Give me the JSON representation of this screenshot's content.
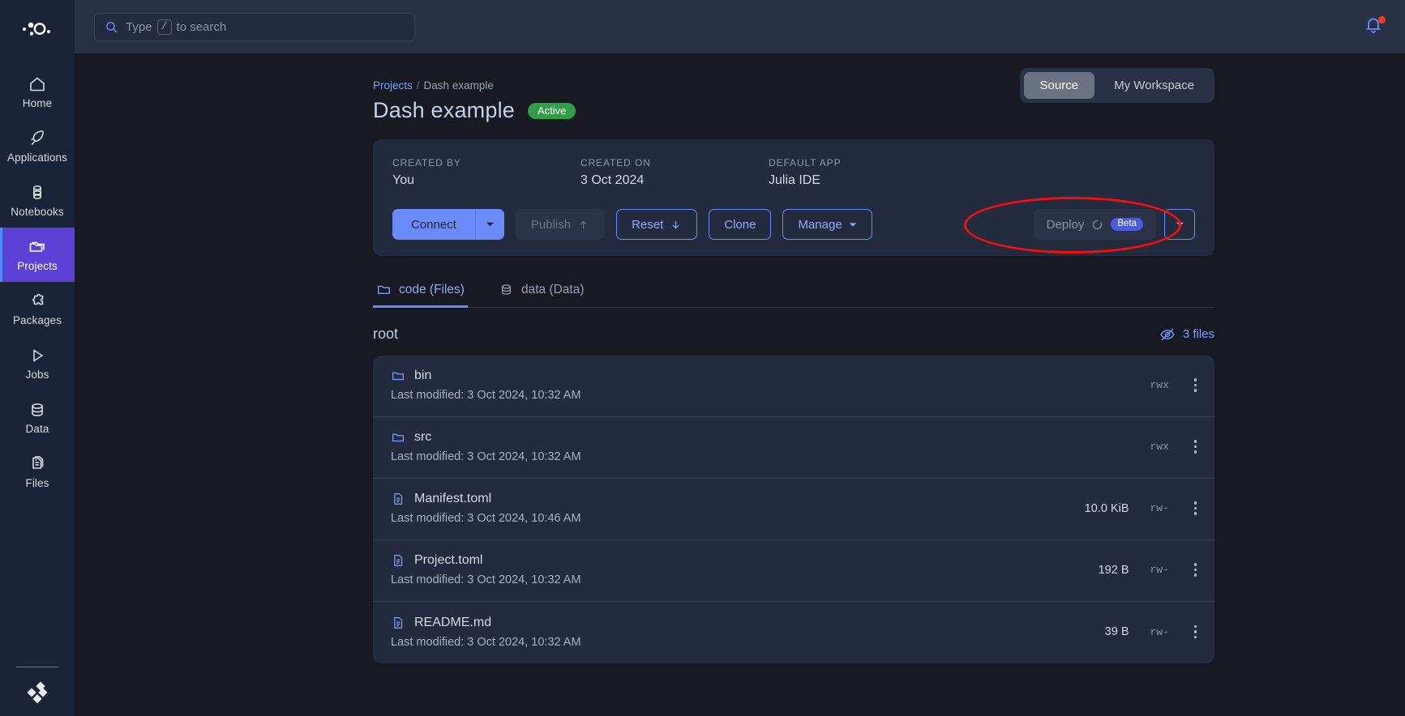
{
  "sidebar": {
    "logo": "dots-logo-icon",
    "items": [
      {
        "label": "Home",
        "icon": "home-icon",
        "active": false
      },
      {
        "label": "Applications",
        "icon": "rocket-icon",
        "active": false
      },
      {
        "label": "Notebooks",
        "icon": "notebook-stack-icon",
        "active": false
      },
      {
        "label": "Projects",
        "icon": "folder-icon",
        "active": true
      },
      {
        "label": "Packages",
        "icon": "puzzle-piece-icon",
        "active": false
      },
      {
        "label": "Jobs",
        "icon": "play-triangle-icon",
        "active": false
      },
      {
        "label": "Data",
        "icon": "database-icon",
        "active": false
      },
      {
        "label": "Files",
        "icon": "documents-icon",
        "active": false
      }
    ],
    "bottom_icon": "diamond-cluster-icon",
    "active_color": "#5b41d6"
  },
  "topbar": {
    "search_placeholder_before": "Type",
    "search_key": "/",
    "search_placeholder_after": "to search",
    "search_value": "",
    "search_icon": "search-icon",
    "notification_icon": "bell-icon",
    "notification_badge": true
  },
  "breadcrumb": {
    "root": "Projects",
    "separator": "/",
    "current": "Dash example"
  },
  "header": {
    "title": "Dash example",
    "status_badge": "Active",
    "status_color": "#2f9e44",
    "toggle": {
      "options": [
        "Source",
        "My Workspace"
      ],
      "selected": "Source"
    }
  },
  "meta": [
    {
      "label": "CREATED BY",
      "value": "You"
    },
    {
      "label": "CREATED ON",
      "value": "3 Oct 2024"
    },
    {
      "label": "DEFAULT APP",
      "value": "Julia IDE"
    }
  ],
  "actions": {
    "connect": "Connect",
    "connect_caret": "chevron-down-icon",
    "publish": "Publish",
    "publish_icon": "arrow-up-icon",
    "publish_disabled": true,
    "reset": "Reset",
    "reset_icon": "arrow-down-icon",
    "clone": "Clone",
    "manage": "Manage",
    "manage_caret": "caret-down-icon",
    "deploy": "Deploy",
    "deploy_icon": "spinner-icon",
    "deploy_badge": "Beta",
    "deploy_caret": "chevron-down-icon",
    "highlight_color": "#ee1111"
  },
  "tabs": [
    {
      "label": "code (Files)",
      "icon": "folder-icon",
      "active": true
    },
    {
      "label": "data (Data)",
      "icon": "database-icon",
      "active": false
    }
  ],
  "filelist": {
    "root_label": "root",
    "visibility_icon": "eye-slash-icon",
    "files_count": "3 files",
    "rows": [
      {
        "name": "bin",
        "icon": "folder-icon",
        "modified": "Last modified: 3 Oct 2024, 10:32 AM",
        "size": "",
        "perm": "rwx"
      },
      {
        "name": "src",
        "icon": "folder-icon",
        "modified": "Last modified: 3 Oct 2024, 10:32 AM",
        "size": "",
        "perm": "rwx"
      },
      {
        "name": "Manifest.toml",
        "icon": "file-icon",
        "modified": "Last modified: 3 Oct 2024, 10:46 AM",
        "size": "10.0 KiB",
        "perm": "rw-"
      },
      {
        "name": "Project.toml",
        "icon": "file-icon",
        "modified": "Last modified: 3 Oct 2024, 10:32 AM",
        "size": "192 B",
        "perm": "rw-"
      },
      {
        "name": "README.md",
        "icon": "file-icon",
        "modified": "Last modified: 3 Oct 2024, 10:32 AM",
        "size": "39 B",
        "perm": "rw-"
      }
    ]
  }
}
